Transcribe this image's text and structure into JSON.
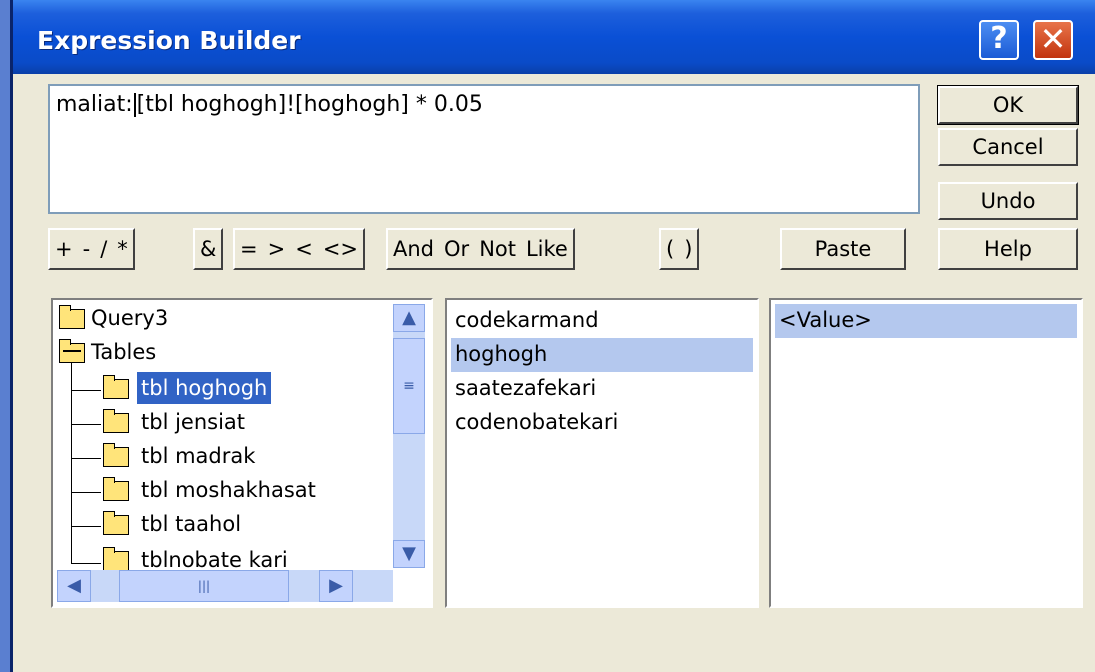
{
  "window": {
    "title": "Expression Builder",
    "help_glyph": "?",
    "close_glyph": "✕"
  },
  "expression": {
    "before_caret": "maliat:",
    "after_caret": "[tbl hoghogh]![hoghogh]  * 0.05"
  },
  "buttons": {
    "ok": "OK",
    "cancel": "Cancel",
    "undo": "Undo",
    "paste": "Paste",
    "help": "Help"
  },
  "operators": {
    "g1": [
      "+",
      "-",
      "/",
      "*"
    ],
    "g2": [
      "&"
    ],
    "g3": [
      "=",
      ">",
      "<",
      "<>"
    ],
    "g4": [
      "And",
      "Or",
      "Not",
      "Like"
    ],
    "g5": [
      "(",
      ")"
    ]
  },
  "tree": {
    "root": "Query3",
    "tables_label": "Tables",
    "items": [
      "tbl hoghogh",
      "tbl jensiat",
      "tbl madrak",
      "tbl moshakhasat",
      "tbl taahol",
      "tblnobate kari"
    ],
    "selected_index": 0
  },
  "fields": {
    "items": [
      "codekarmand",
      "hoghogh",
      "saatezafekari",
      "codenobatekari"
    ],
    "selected_index": 1
  },
  "values": {
    "items": [
      "<Value>"
    ],
    "selected_index": 0
  },
  "colors": {
    "title_bar": "#0a50d6",
    "dialog_bg": "#ece9d8",
    "selection": "#b4c8ee",
    "selection_focus": "#3163c5"
  }
}
